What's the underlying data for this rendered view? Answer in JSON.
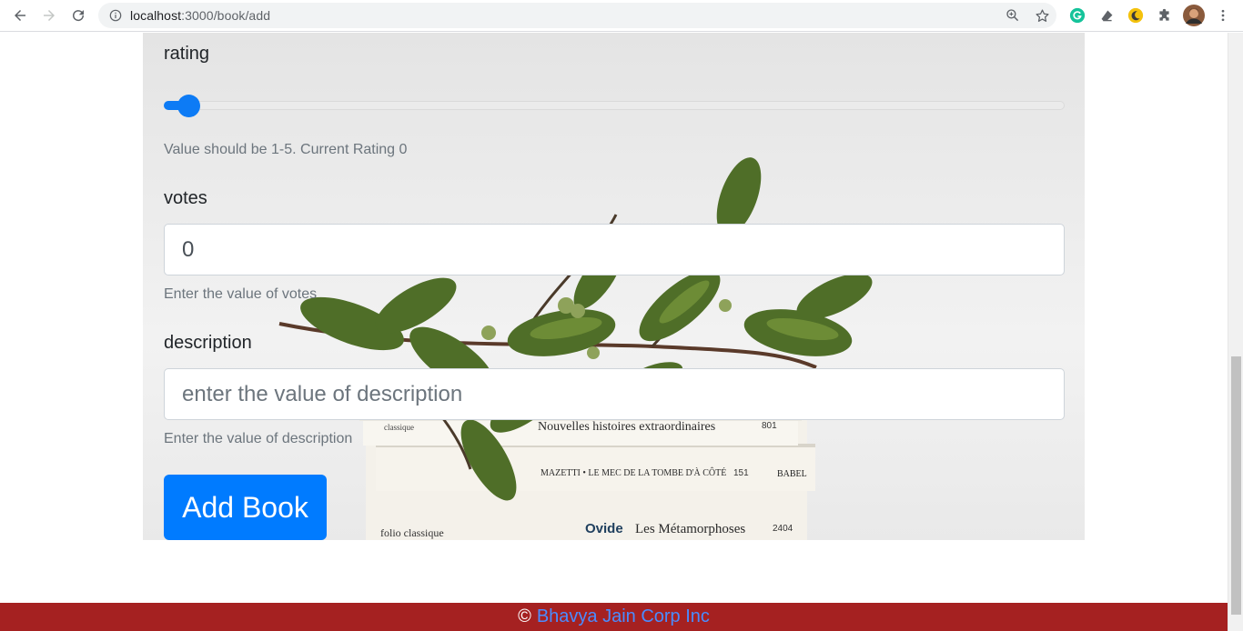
{
  "browser": {
    "url_host": "localhost",
    "url_rest": ":3000/book/add"
  },
  "form": {
    "rating": {
      "label": "rating",
      "value": 0,
      "min": 1,
      "max": 5,
      "hint": "Value should be 1-5. Current Rating 0"
    },
    "votes": {
      "label": "votes",
      "value": "0",
      "hint": "Enter the value of votes"
    },
    "description": {
      "label": "description",
      "placeholder": "enter the value of description",
      "value": "",
      "hint": "Enter the value of description"
    },
    "submit_label": "Add Book"
  },
  "background_books": {
    "top": "Nouvelles histoires extraordinaires",
    "top_spine": "801",
    "top_publisher": "classique",
    "middle": "MAZETTI • LE MEC DE LA TOMBE D'À CÔTÉ",
    "middle_spine": "151",
    "middle_publisher": "BABEL",
    "bottom_publisher": "folio classique",
    "bottom_author": "Ovide",
    "bottom_title": "Les Métamorphoses",
    "bottom_spine": "2404"
  },
  "footer": {
    "copyright": "©",
    "company": "Bhavya Jain Corp Inc"
  },
  "colors": {
    "primary": "#007bff",
    "footer_bg": "#a52121",
    "footer_link": "#4a8cff"
  }
}
